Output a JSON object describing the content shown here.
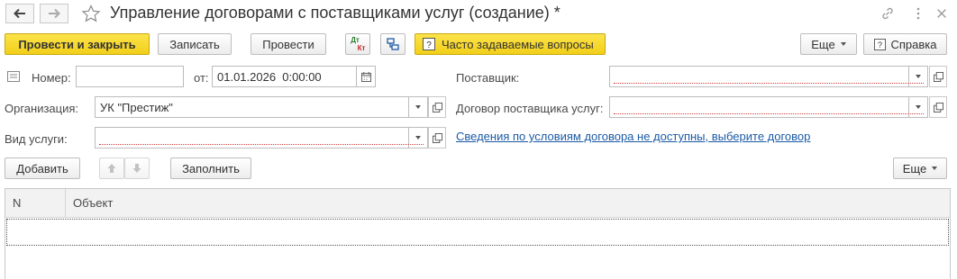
{
  "header": {
    "title": "Управление договорами с поставщиками услуг (создание) *"
  },
  "toolbar": {
    "post_close": "Провести и закрыть",
    "save": "Записать",
    "post": "Провести",
    "dtkt_top": "Дт",
    "dtkt_bottom": "Кт",
    "faq": "Часто задаваемые вопросы",
    "more": "Еще",
    "help": "Справка"
  },
  "form": {
    "number_label": "Номер:",
    "number_value": "",
    "date_label": "от:",
    "date_value": "01.01.2026  0:00:00",
    "org_label": "Организация:",
    "org_value": "УК \"Престиж\"",
    "service_label": "Вид услуги:",
    "service_value": "",
    "supplier_label": "Поставщик:",
    "supplier_value": "",
    "contract_label": "Договор поставщика услуг:",
    "contract_value": "",
    "contract_info_link": "Сведения по условиям договора не доступны, выберите договор"
  },
  "table_toolbar": {
    "add": "Добавить",
    "fill": "Заполнить",
    "more": "Еще"
  },
  "table": {
    "columns": [
      "N",
      "Объект"
    ],
    "rows": []
  },
  "colors": {
    "primary_button": "#f2cf1a",
    "link": "#1b5aa6",
    "required_underline": "#d23c3c"
  }
}
